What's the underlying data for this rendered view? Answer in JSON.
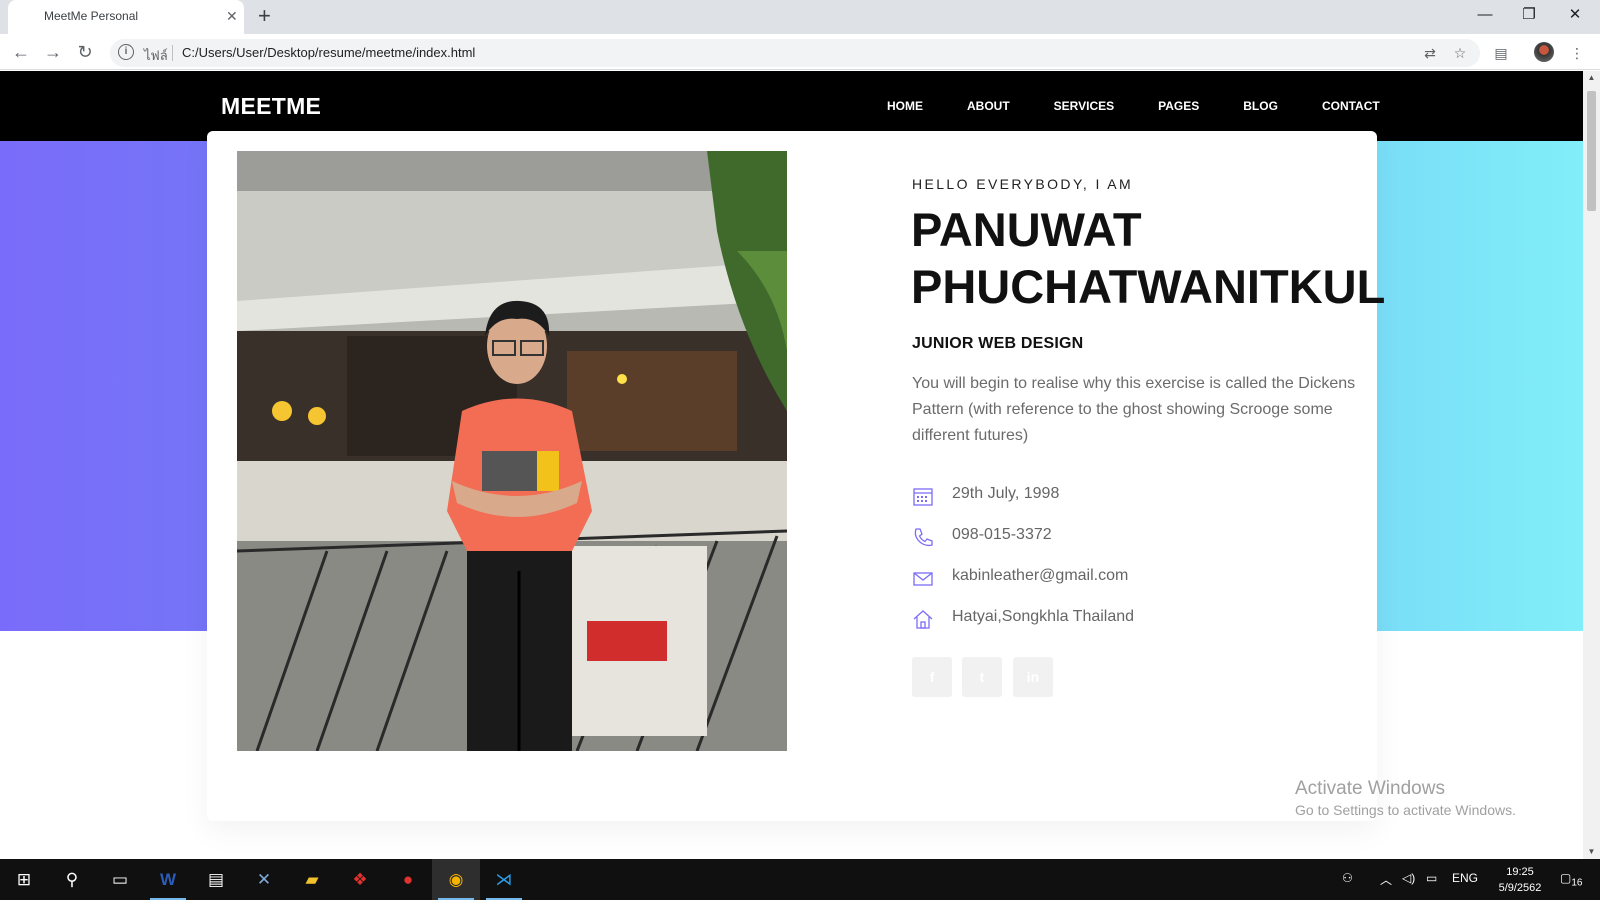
{
  "browser": {
    "tab_title": "MeetMe Personal",
    "new_tab": "+",
    "address_prefix": "ไฟล์",
    "url": "C:/Users/User/Desktop/resume/meetme/index.html"
  },
  "site": {
    "logo": "MEETME",
    "menu": [
      "HOME",
      "ABOUT",
      "SERVICES",
      "PAGES",
      "BLOG",
      "CONTACT"
    ]
  },
  "hero": {
    "greeting": "HELLO EVERYBODY, I AM",
    "name_line1": "PANUWAT",
    "name_line2": "PHUCHATWANITKUL",
    "role": "JUNIOR WEB DESIGN",
    "bio": "You will begin to realise why this exercise is called the Dickens Pattern (with reference to the ghost showing Scrooge some different futures)",
    "info": [
      {
        "icon": "calendar-icon",
        "text": "29th July, 1998"
      },
      {
        "icon": "phone-icon",
        "text": "098-015-3372"
      },
      {
        "icon": "mail-icon",
        "text": "kabinleather@gmail.com"
      },
      {
        "icon": "home-icon",
        "text": "Hatyai,Songkhla Thailand"
      }
    ],
    "socials": [
      {
        "icon": "facebook-icon",
        "glyph": "f"
      },
      {
        "icon": "twitter-icon",
        "glyph": "t"
      },
      {
        "icon": "linkedin-icon",
        "glyph": "in"
      }
    ]
  },
  "watermark": {
    "title": "Activate Windows",
    "subtitle": "Go to Settings to activate Windows."
  },
  "taskbar": {
    "language": "ENG",
    "time": "19:25",
    "date": "5/9/2562",
    "notification_count": "16"
  },
  "colors": {
    "hero_left": "#7a6cfa",
    "hero_right": "#81eef9",
    "accent_icon": "#7b6cf6",
    "nav_bg": "#000000"
  }
}
